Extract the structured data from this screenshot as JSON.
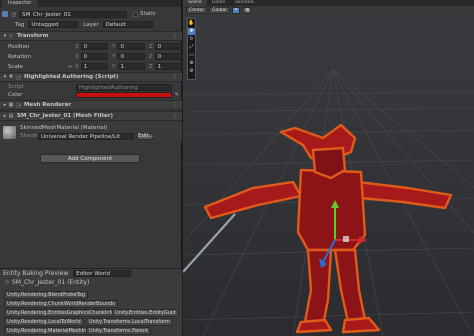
{
  "inspector": {
    "tab_label": "Inspector",
    "object_name": "SM_Chr_Jester_01",
    "static_label": "Static",
    "tag_label": "Tag",
    "tag_value": "Untagged",
    "layer_label": "Layer",
    "layer_value": "Default",
    "transform": {
      "title": "Transform",
      "position_label": "Position",
      "rotation_label": "Rotation",
      "scale_label": "Scale",
      "position": {
        "x": "0",
        "y": "0",
        "z": "0"
      },
      "rotation": {
        "x": "0",
        "y": "0",
        "z": "0"
      },
      "scale": {
        "x": "1",
        "y": "1",
        "z": "1"
      },
      "x_label": "X",
      "y_label": "Y",
      "z_label": "Z"
    },
    "highlighted_authoring": {
      "title": "Highlighted Authoring (Script)",
      "script_label": "Script",
      "script_value": "HighlightedAuthoring",
      "color_label": "Color",
      "color_value": "#c81010"
    },
    "mesh_renderer": {
      "title": "Mesh Renderer"
    },
    "mesh_filter": {
      "title": "SM_Chr_Jester_01 (Mesh Filter)"
    },
    "material": {
      "title": "SkinnedMeshMaterial (Material)",
      "shader_label": "Shader",
      "shader_value": "Universal Render Pipeline/Lit",
      "edit_label": "Edit..."
    },
    "add_component_label": "Add Component"
  },
  "entity_baking": {
    "title": "Entity Baking Preview",
    "world_value": "Editor World",
    "entity_label": "SM_Chr_Jester_01 (Entity)",
    "tags": [
      [
        "Unity.Rendering.BlendProbeTag"
      ],
      [
        "Unity.Rendering.ChunkWorldRenderBounds"
      ],
      [
        "Unity.Rendering.EntitiesGraphicsChunkInfo",
        "Unity.Entities.EntityGuid"
      ],
      [
        "Unity.Rendering.LocalToWorld",
        "Unity.Transforms.LocalTransform"
      ],
      [
        "Unity.Rendering.MaterialMeshInfo",
        "Unity.Transforms.Parent"
      ]
    ]
  },
  "scene": {
    "tabs": [
      "Scene",
      "Game",
      "Skinned..."
    ],
    "pivot_label": "Center",
    "space_label": "Global"
  },
  "colors": {
    "highlight": "#e05a1a",
    "body": "#a8191b",
    "accent": "#4a7ec0"
  }
}
